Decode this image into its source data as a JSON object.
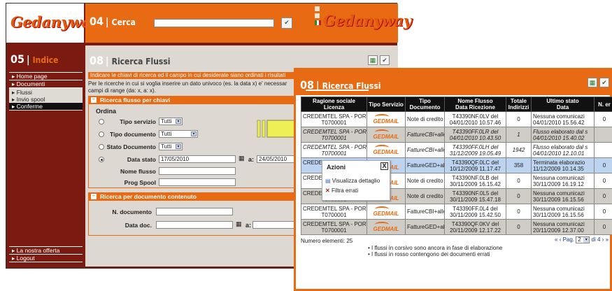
{
  "brand": "Gedanyway",
  "top": {
    "section_num": "04",
    "section_title": "Cerca"
  },
  "sidebar": {
    "section_num": "05",
    "section_title": "Indice",
    "items": [
      {
        "label": "Home page"
      },
      {
        "label": "Documenti"
      },
      {
        "label": "Flussi"
      },
      {
        "label": "Invio spool"
      },
      {
        "label": "Conferme"
      }
    ],
    "bottom_items": [
      {
        "label": "La nostra offerta"
      },
      {
        "label": "Logout"
      }
    ]
  },
  "back": {
    "section_num": "08",
    "section_title": "Ricerca Flussi",
    "intro1": "Indicare le chiavi di ricerca ed il campo in cui desiderate siano ordinati i risultati",
    "intro2": "Per le ricerche in cui si voglia inserire un dato univoco (es. la data x) e' necessar",
    "intro3": "campi di range (da: x, a: x).",
    "box1_title": "Ricerca flusso per chiavi",
    "ordina": "Ordina",
    "tipo_servizio_label": "Tipo servizio",
    "tipo_servizio_value": "Tutti",
    "tipo_documento_label": "Tipo documento",
    "tipo_documento_value": "Tutti",
    "stato_documento_label": "Stato Documento",
    "stato_documento_value": "Tutti",
    "data_stato_label": "Data stato",
    "data_stato_from": "17/05/2010",
    "data_stato_a": "a:",
    "data_stato_to": "24/05/2010",
    "nome_flusso_label": "Nome flusso",
    "prog_spool_label": "Prog Spool",
    "box2_title": "Ricerca per documento contenuto",
    "n_documento_label": "N. documento",
    "data_doc_label": "Data doc.",
    "data_doc_a": "a:"
  },
  "front": {
    "section_num": "08",
    "section_title": "Ricerca Flussi",
    "columns": [
      "Ragione sociale\nLicenza",
      "Tipo Servizio",
      "Tipo Documento",
      "Nome Flusso\nData Ricezione",
      "Totale\nIndirizzi",
      "Ultimo stato\nData",
      "N. er"
    ],
    "rows": [
      {
        "ragione": "CREDEMTEL SPA - PORT",
        "licenza": "T0700001",
        "servizio": "GEDMAIL",
        "tipo": "Note di credito",
        "nome": "T43390NF.0LV del",
        "data": "04/01/2010 10.57.46",
        "tot": "0",
        "stato": "Nessuna comunicazi",
        "stato_data": "04/01/2010 15.56.42",
        "ner": "0",
        "style": "w",
        "italic": false
      },
      {
        "ragione": "CREDEMTEL SPA - PORTA",
        "licenza": "T0700001",
        "servizio": "GEDMAIL",
        "tipo": "FattureCBI+allegat",
        "nome": "T43390FF.0LR del",
        "data": "04/01/2010 10.43.50",
        "tot": "1",
        "stato": "Flusso elaborato dal s",
        "stato_data": "04/01/2010 15.40.02",
        "ner": "",
        "style": "g",
        "italic": true
      },
      {
        "ragione": "CREDEMTEL SPA - PORT",
        "licenza": "T0700001",
        "servizio": "GEDMAIL",
        "tipo": "FattureCBI+allegat",
        "nome": "T43390FF.0LH del",
        "data": "31/12/2009 19.05.49",
        "tot": "1942",
        "stato": "Flusso elaborato dal s",
        "stato_data": "04/01/2010 12.10.01",
        "ner": "",
        "style": "w",
        "italic": true
      },
      {
        "ragione": "CREDEMTEL SPA - PORT",
        "licenza": "T0700001",
        "servizio": "GEDMAIL",
        "tipo": "FattureGED+allega",
        "nome": "T43390QF.0LC del",
        "data": "10/12/2009 11.17.47",
        "tot": "358",
        "stato": "Terminata elaborazio",
        "stato_data": "11/12/2009 10.14.35",
        "ner": "0",
        "style": "b",
        "italic": false
      },
      {
        "ragione": "CREDEMTEL SPA - PORT",
        "licenza": "T0700001",
        "servizio": "GEDMAIL",
        "tipo": "Note di credito",
        "nome": "T43390NF.0LB del",
        "data": "30/11/2009 16.15.42",
        "tot": "0",
        "stato": "Nessuna comunicazi",
        "stato_data": "30/11/2009 16.19.12",
        "ner": "0",
        "style": "w",
        "italic": false
      },
      {
        "ragione": "CREDEMTEL SPA - PORT",
        "licenza": "T0700001",
        "servizio": "GEDMAIL",
        "tipo": "Note di credito",
        "nome": "T43390NF.0L5 del",
        "data": "30/11/2009 15.47.18",
        "tot": "0",
        "stato": "Nessuna comunicazi",
        "stato_data": "30/11/2009 16.15.56",
        "ner": "0",
        "style": "g",
        "italic": false
      },
      {
        "ragione": "CREDEMTEL SPA - PORT",
        "licenza": "T0700001",
        "servizio": "GEDMAIL",
        "tipo": "FattureCBI+allega",
        "nome": "T43390FF.0L4 del",
        "data": "30/11/2009 15.42.50",
        "tot": "0",
        "stato": "Nessuna comunicazi",
        "stato_data": "30/11/2009 16.15.56",
        "ner": "0",
        "style": "w",
        "italic": false
      },
      {
        "ragione": "CREDEMTEL SPA - PORT",
        "licenza": "T0700001",
        "servizio": "GEDMAIL",
        "tipo": "FattureGED+allega",
        "nome": "T43390QF.0KV del",
        "data": "20/11/2009 12.17.22",
        "tot": "0",
        "stato": "Nessuna comunicazi",
        "stato_data": "20/11/2009 12.37.00",
        "ner": "0",
        "style": "g",
        "italic": false
      }
    ],
    "count": "Numero elementi: 25",
    "note1": "I flussi in corsivo sono ancora in fase di elaborazione",
    "note2": "I flussi in rosso contengono dei documenti errati",
    "pag_label": "Pag.",
    "pag_value": "2",
    "pag_of": "di 4"
  },
  "actions": {
    "title": "Azioni",
    "close": "X",
    "items": [
      {
        "label": "Visualizza dettaglio"
      },
      {
        "label": "Filtra errati"
      }
    ]
  },
  "colors": {
    "accent": "#e86a12",
    "dark_red": "#7a1a10",
    "highlight_row": "#bcd4f0",
    "arrow_fill": "#eeee55"
  }
}
